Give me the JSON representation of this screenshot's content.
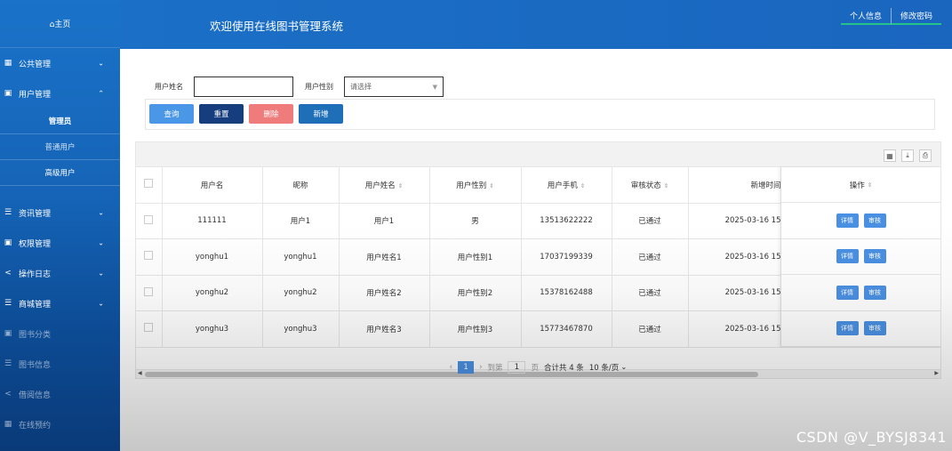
{
  "sidebar": {
    "home": "⌂主页",
    "menus": [
      {
        "icon": "▦",
        "label": "公共管理",
        "arrow": "⌄"
      },
      {
        "icon": "▣",
        "label": "用户管理",
        "arrow": "⌃"
      }
    ],
    "submenu": [
      {
        "label": "管理员"
      },
      {
        "label": "普通用户"
      },
      {
        "label": "高级用户"
      }
    ],
    "menus2": [
      {
        "icon": "☰",
        "label": "资讯管理",
        "arrow": "⌄"
      },
      {
        "icon": "▣",
        "label": "权限管理",
        "arrow": "⌄"
      },
      {
        "icon": "<",
        "label": "操作日志",
        "arrow": "⌄"
      },
      {
        "icon": "☰",
        "label": "商城管理",
        "arrow": "⌄"
      },
      {
        "icon": "▣",
        "label": "图书分类"
      },
      {
        "icon": "☰",
        "label": "图书信息"
      },
      {
        "icon": "<",
        "label": "借阅信息"
      },
      {
        "icon": "▦",
        "label": "在线预约"
      }
    ]
  },
  "header": {
    "title": "欢迎使用在线图书管理系统",
    "links": [
      "个人信息",
      "修改密码"
    ]
  },
  "search": {
    "name_label": "用户姓名",
    "name_value": "",
    "gender_label": "用户性别",
    "gender_placeholder": "请选择"
  },
  "buttons": {
    "query": "查询",
    "reset": "重置",
    "delete": "删除",
    "add": "新增"
  },
  "table": {
    "headers": [
      "用户名",
      "昵称",
      "用户姓名",
      "用户性别",
      "用户手机",
      "审核状态",
      "新增时间",
      "操作"
    ],
    "rows": [
      [
        "111111",
        "用户1",
        "用户1",
        "男",
        "13513622222",
        "已通过",
        "2025-03-16 15"
      ],
      [
        "yonghu1",
        "yonghu1",
        "用户姓名1",
        "用户性别1",
        "17037199339",
        "已通过",
        "2025-03-16 15"
      ],
      [
        "yonghu2",
        "yonghu2",
        "用户姓名2",
        "用户性别2",
        "15378162488",
        "已通过",
        "2025-03-16 15"
      ],
      [
        "yonghu3",
        "yonghu3",
        "用户姓名3",
        "用户性别3",
        "15773467870",
        "已通过",
        "2025-03-16 15"
      ]
    ],
    "row_actions": [
      "详情",
      "审核"
    ]
  },
  "pager": {
    "prev": "‹",
    "current": "1",
    "next": "›",
    "goto_label": "到第",
    "goto_value": "1",
    "page_unit": "页",
    "total": "合计共 4 条",
    "page_size": "10 条/页",
    "page_size_caret": "⌄"
  },
  "watermark": "CSDN @V_BYSJ8341"
}
